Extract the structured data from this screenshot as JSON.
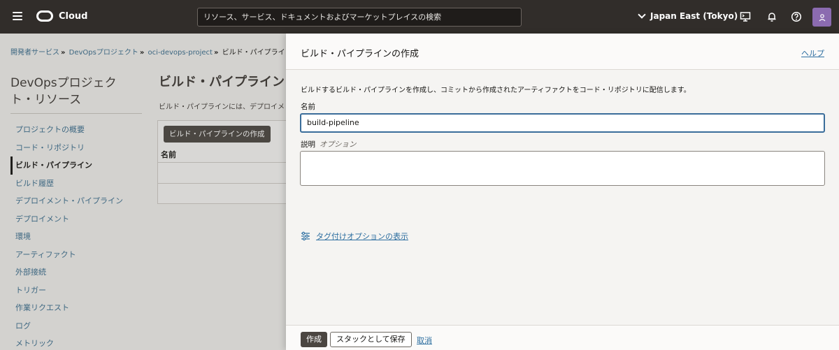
{
  "header": {
    "logo_text": "Cloud",
    "search_placeholder": "リソース、サービス、ドキュメントおよびマーケットプレイスの検索",
    "region": "Japan East (Tokyo)",
    "icons": [
      "menu-icon",
      "cloud-logo-icon",
      "chevron-down-icon",
      "cloud-shell-icon",
      "bell-icon",
      "help-icon",
      "user-icon"
    ]
  },
  "breadcrumb": {
    "items": [
      "開発者サービス",
      "DevOpsプロジェクト",
      "oci-devops-project",
      "ビルド・パイプライン"
    ],
    "separator": "»"
  },
  "sidebar": {
    "title": "DevOpsプロジェクト・リソース",
    "items": [
      {
        "label": "プロジェクトの概要",
        "active": false
      },
      {
        "label": "コード・リポジトリ",
        "active": false
      },
      {
        "label": "ビルド・パイプライン",
        "active": true
      },
      {
        "label": "ビルド履歴",
        "active": false
      },
      {
        "label": "デプロイメント・パイプライン",
        "active": false
      },
      {
        "label": "デプロイメント",
        "active": false
      },
      {
        "label": "環境",
        "active": false
      },
      {
        "label": "アーティファクト",
        "active": false
      },
      {
        "label": "外部接続",
        "active": false
      },
      {
        "label": "トリガー",
        "active": false
      },
      {
        "label": "作業リクエスト",
        "active": false
      },
      {
        "label": "ログ",
        "active": false
      },
      {
        "label": "メトリック",
        "active": false
      }
    ]
  },
  "main": {
    "title": "ビルド・パイプライン",
    "description": "ビルド・パイプラインには、デプロイメ",
    "create_button": "ビルド・パイプラインの作成",
    "table_header_name": "名前"
  },
  "panel": {
    "title": "ビルド・パイプラインの作成",
    "help_link": "ヘルプ",
    "intro": "ビルドするビルド・パイプラインを作成し、コミットから作成されたアーティファクトをコード・リポジトリに配信します。",
    "name_label": "名前",
    "name_value": "build-pipeline",
    "description_label": "説明",
    "description_optional": "オプション",
    "description_value": "",
    "tag_link": "タグ付けオプションの表示",
    "create_button": "作成",
    "save_stack_button": "スタックとして保存",
    "cancel_link": "取消"
  },
  "colors": {
    "header_bg": "#312d2a",
    "link": "#2d6ea0",
    "primary_button": "#4b4641",
    "avatar": "#8b6bb0",
    "input_focus": "#3a6d9a"
  }
}
